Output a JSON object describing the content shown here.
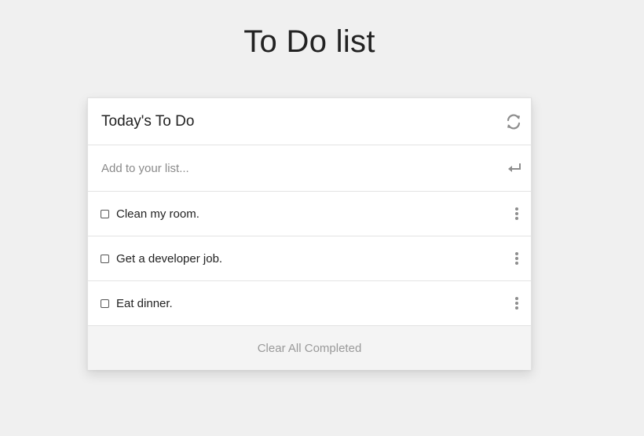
{
  "page": {
    "title": "To Do list"
  },
  "card": {
    "title": "Today's To Do",
    "refresh_icon": "refresh-icon",
    "add_placeholder": "Add to your list...",
    "add_value": "",
    "enter_icon": "enter-icon",
    "items": [
      {
        "text": "Clean my room.",
        "checked": false,
        "menu_icon": "kebab-menu-icon"
      },
      {
        "text": "Get a developer job.",
        "checked": false,
        "menu_icon": "kebab-menu-icon"
      },
      {
        "text": "Eat dinner.",
        "checked": false,
        "menu_icon": "kebab-menu-icon"
      }
    ],
    "clear_label": "Clear All Completed"
  },
  "colors": {
    "background": "#f0f0f0",
    "card": "#ffffff",
    "footer": "#f4f4f4",
    "muted_icon": "#8d8d8d",
    "footer_text": "#999999"
  }
}
